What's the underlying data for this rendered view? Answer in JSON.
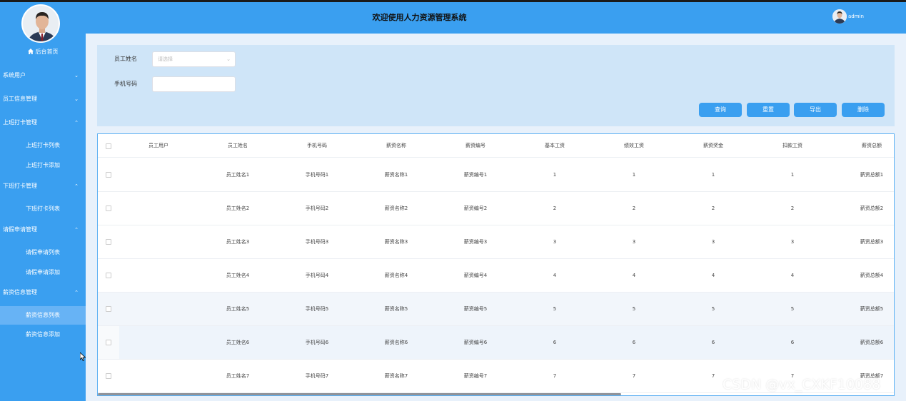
{
  "header": {
    "title": "欢迎使用人力资源管理系统",
    "username": "admin"
  },
  "sidebar": {
    "home": "后台首页",
    "groups": [
      {
        "label": "系统用户",
        "expanded": false,
        "items": []
      },
      {
        "label": "员工信息管理",
        "expanded": false,
        "items": []
      },
      {
        "label": "上班打卡管理",
        "expanded": true,
        "items": [
          "上班打卡列表",
          "上班打卡添加"
        ]
      },
      {
        "label": "下班打卡管理",
        "expanded": true,
        "items": [
          "下班打卡列表"
        ]
      },
      {
        "label": "请假申请管理",
        "expanded": true,
        "items": [
          "请假申请列表",
          "请假申请添加"
        ]
      },
      {
        "label": "薪资信息管理",
        "expanded": true,
        "items": [
          "薪资信息列表",
          "薪资信息添加"
        ]
      }
    ],
    "active_item": "薪资信息列表"
  },
  "search": {
    "name_label": "员工姓名",
    "name_placeholder": "请选择",
    "phone_label": "手机号码",
    "phone_value": "",
    "buttons": {
      "query": "查询",
      "reset": "重置",
      "export": "导出",
      "delete": "删除"
    }
  },
  "table": {
    "columns": [
      "员工用户",
      "员工姓名",
      "手机号码",
      "薪资名称",
      "薪资编号",
      "基本工资",
      "绩效工资",
      "薪资奖金",
      "扣款工资",
      "薪资总额"
    ],
    "rows": [
      [
        "",
        "员工姓名1",
        "手机号码1",
        "薪资名称1",
        "薪资编号1",
        "1",
        "1",
        "1",
        "1",
        "薪资总额1"
      ],
      [
        "",
        "员工姓名2",
        "手机号码2",
        "薪资名称2",
        "薪资编号2",
        "2",
        "2",
        "2",
        "2",
        "薪资总额2"
      ],
      [
        "",
        "员工姓名3",
        "手机号码3",
        "薪资名称3",
        "薪资编号3",
        "3",
        "3",
        "3",
        "3",
        "薪资总额3"
      ],
      [
        "",
        "员工姓名4",
        "手机号码4",
        "薪资名称4",
        "薪资编号4",
        "4",
        "4",
        "4",
        "4",
        "薪资总额4"
      ],
      [
        "",
        "员工姓名5",
        "手机号码5",
        "薪资名称5",
        "薪资编号5",
        "5",
        "5",
        "5",
        "5",
        "薪资总额5"
      ],
      [
        "",
        "员工姓名6",
        "手机号码6",
        "薪资名称6",
        "薪资编号6",
        "6",
        "6",
        "6",
        "6",
        "薪资总额6"
      ],
      [
        "",
        "员工姓名7",
        "手机号码7",
        "薪资名称7",
        "薪资编号7",
        "7",
        "7",
        "7",
        "7",
        "薪资总额7"
      ]
    ]
  },
  "watermark": "CSDN @vx_CXKF10088",
  "colors": {
    "primary": "#3a9ff0",
    "active_menu": "#67b3f5",
    "search_panel": "#cfe5f8"
  }
}
